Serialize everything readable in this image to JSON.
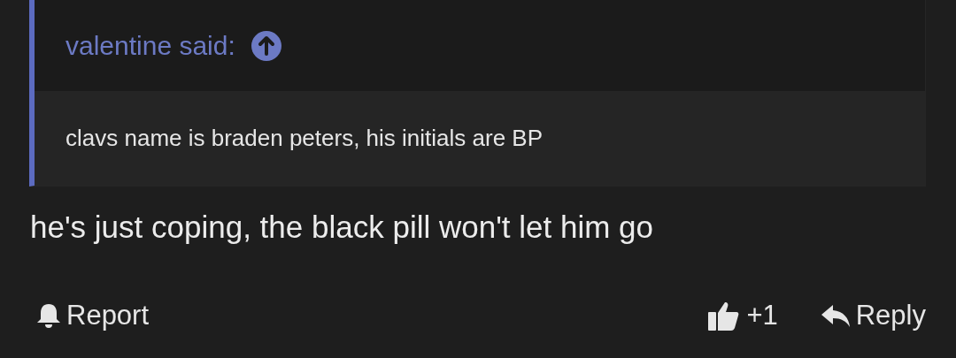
{
  "quote": {
    "author": "valentine said:",
    "text": "clavs name is braden peters, his initials are BP"
  },
  "message": "he's just coping, the black pill won't let him go",
  "actions": {
    "report": "Report",
    "reaction_count": "+1",
    "reply": "Reply"
  }
}
